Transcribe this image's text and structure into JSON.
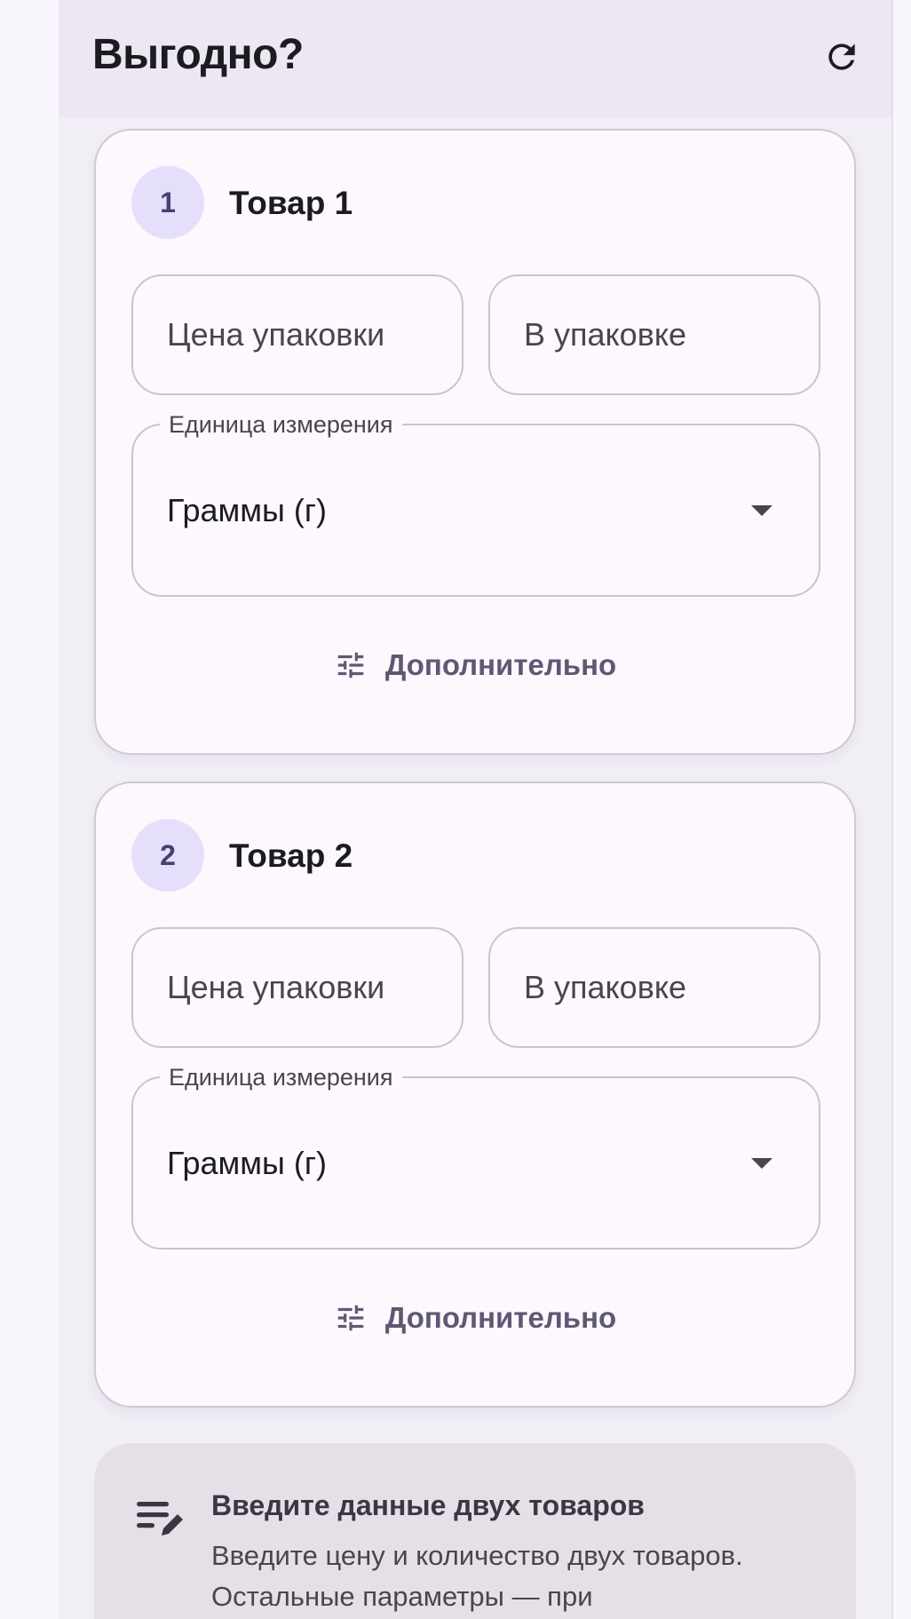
{
  "app": {
    "title": "Выгодно?",
    "refresh_icon": "refresh-icon"
  },
  "products": [
    {
      "number": "1",
      "title": "Товар 1",
      "price_placeholder": "Цена упаковки",
      "qty_placeholder": "В упаковке",
      "unit_label": "Единица измерения",
      "unit_value": "Граммы (г)",
      "more_label": "Дополнительно"
    },
    {
      "number": "2",
      "title": "Товар 2",
      "price_placeholder": "Цена упаковки",
      "qty_placeholder": "В упаковке",
      "unit_label": "Единица измерения",
      "unit_value": "Граммы (г)",
      "more_label": "Дополнительно"
    }
  ],
  "info": {
    "title": "Введите данные двух товаров",
    "text": "Введите цену и количество двух товаров. Остальные параметры — при"
  },
  "colors": {
    "badge_bg": "#e6dffb",
    "badge_text": "#4a3f73",
    "accent_text": "#5f5874"
  }
}
